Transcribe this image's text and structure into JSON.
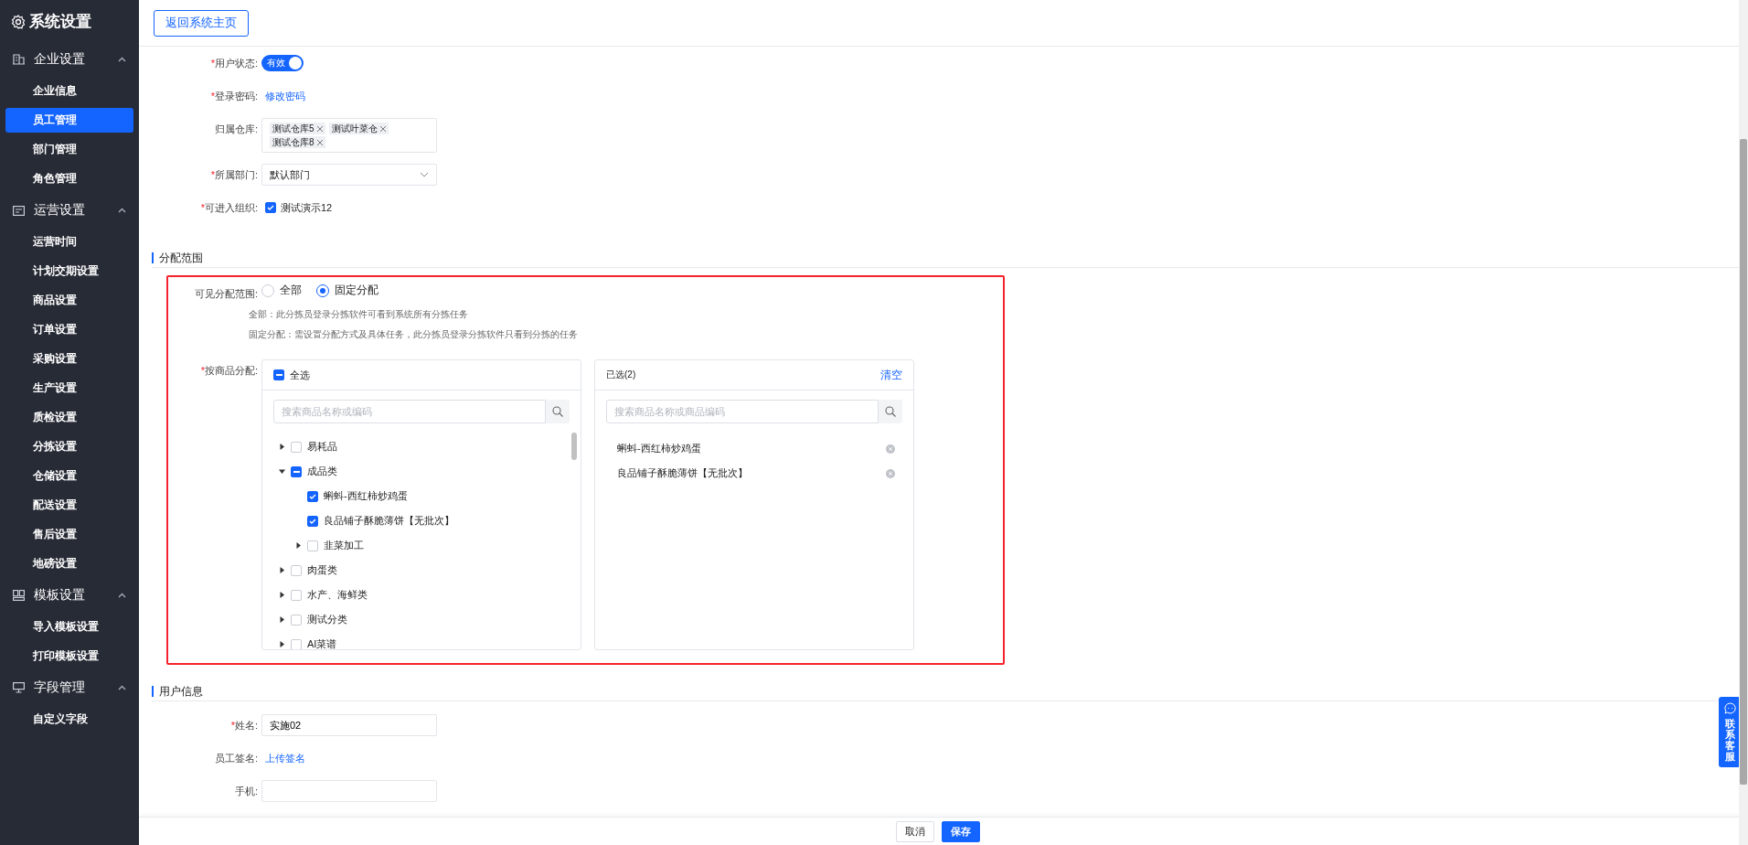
{
  "sidebar": {
    "title": "系统设置",
    "groups": [
      {
        "title": "企业设置",
        "expanded": true,
        "items": [
          {
            "label": "企业信息",
            "selected": false
          },
          {
            "label": "员工管理",
            "selected": true
          },
          {
            "label": "部门管理",
            "selected": false
          },
          {
            "label": "角色管理",
            "selected": false
          }
        ]
      },
      {
        "title": "运营设置",
        "expanded": true,
        "items": [
          {
            "label": "运营时间",
            "selected": false
          },
          {
            "label": "计划交期设置",
            "selected": false
          },
          {
            "label": "商品设置",
            "selected": false
          },
          {
            "label": "订单设置",
            "selected": false
          },
          {
            "label": "采购设置",
            "selected": false
          },
          {
            "label": "生产设置",
            "selected": false
          },
          {
            "label": "质检设置",
            "selected": false
          },
          {
            "label": "分拣设置",
            "selected": false
          },
          {
            "label": "仓储设置",
            "selected": false
          },
          {
            "label": "配送设置",
            "selected": false
          },
          {
            "label": "售后设置",
            "selected": false
          },
          {
            "label": "地磅设置",
            "selected": false
          }
        ]
      },
      {
        "title": "模板设置",
        "expanded": true,
        "items": [
          {
            "label": "导入模板设置",
            "selected": false
          },
          {
            "label": "打印模板设置",
            "selected": false
          }
        ]
      },
      {
        "title": "字段管理",
        "expanded": true,
        "items": [
          {
            "label": "自定义字段",
            "selected": false
          }
        ]
      }
    ]
  },
  "header": {
    "back_button": "返回系统主页"
  },
  "basic_fields": [
    {
      "kind": "switch",
      "mark": "*",
      "label": "用户状态:",
      "value": "有效",
      "on": true
    },
    {
      "kind": "link",
      "mark": "*",
      "label": "登录密码:",
      "value": "修改密码"
    },
    {
      "kind": "tags",
      "label": "归属仓库:",
      "tags": [
        "测试仓库5",
        "测试叶菜仓",
        "测试仓库8"
      ]
    },
    {
      "kind": "select",
      "mark": "*",
      "label": "所属部门:",
      "value": "默认部门"
    },
    {
      "kind": "checkbox",
      "mark": "*",
      "label": "可进入组织:",
      "option": "测试演示12",
      "checked": true
    }
  ],
  "distribution": {
    "title": "分配范围",
    "scope": {
      "label": "可见分配范围:",
      "options": [
        {
          "label": "全部",
          "selected": false
        },
        {
          "label": "固定分配",
          "selected": true
        }
      ],
      "notes": [
        "全部：此分拣员登录分拣软件可看到系统所有分拣任务",
        "固定分配：需设置分配方式及具体任务，此分拣员登录分拣软件只看到分拣的任务"
      ]
    },
    "by_product": {
      "mark": "*",
      "label": "按商品分配:",
      "source": {
        "select_all": "全选",
        "checked": false,
        "indeterminate": true,
        "placeholder": "搜索商品名称或编码",
        "tree": [
          {
            "kind": "group",
            "label": "易耗品",
            "expanded": false,
            "checked": false,
            "indeterminate": false
          },
          {
            "kind": "group",
            "label": "成品类",
            "expanded": true,
            "checked": false,
            "indeterminate": true,
            "children": [
              {
                "kind": "leaf",
                "label": "蝌蚪-西红柿炒鸡蛋",
                "checked": true,
                "indeterminate": false
              },
              {
                "kind": "leaf",
                "label": "良品铺子酥脆薄饼【无批次】",
                "checked": true,
                "indeterminate": false
              },
              {
                "kind": "group",
                "label": "韭菜加工",
                "expanded": false,
                "checked": false,
                "indeterminate": false
              }
            ]
          },
          {
            "kind": "group",
            "label": "肉蛋类",
            "expanded": false,
            "checked": false,
            "indeterminate": false
          },
          {
            "kind": "group",
            "label": "水产、海鲜类",
            "expanded": false,
            "checked": false,
            "indeterminate": false
          },
          {
            "kind": "group",
            "label": "测试分类",
            "expanded": false,
            "checked": false,
            "indeterminate": false
          },
          {
            "kind": "group",
            "label": "AI菜谱",
            "expanded": false,
            "checked": false,
            "indeterminate": false
          }
        ]
      },
      "target": {
        "title": "已选(2)",
        "clear": "清空",
        "placeholder": "搜索商品名称或商品编码",
        "items": [
          "蝌蚪-西红柿炒鸡蛋",
          "良品铺子酥脆薄饼【无批次】"
        ]
      }
    }
  },
  "user_info": {
    "title": "用户信息",
    "fields": [
      {
        "kind": "input",
        "mark": "*",
        "label": "姓名:",
        "value": "实施02"
      },
      {
        "kind": "link",
        "label": "员工签名:",
        "value": "上传签名"
      },
      {
        "kind": "input",
        "label": "手机:"
      }
    ]
  },
  "footer": {
    "cancel": "取消",
    "save": "保存"
  },
  "contact": {
    "label": "联系客服"
  }
}
